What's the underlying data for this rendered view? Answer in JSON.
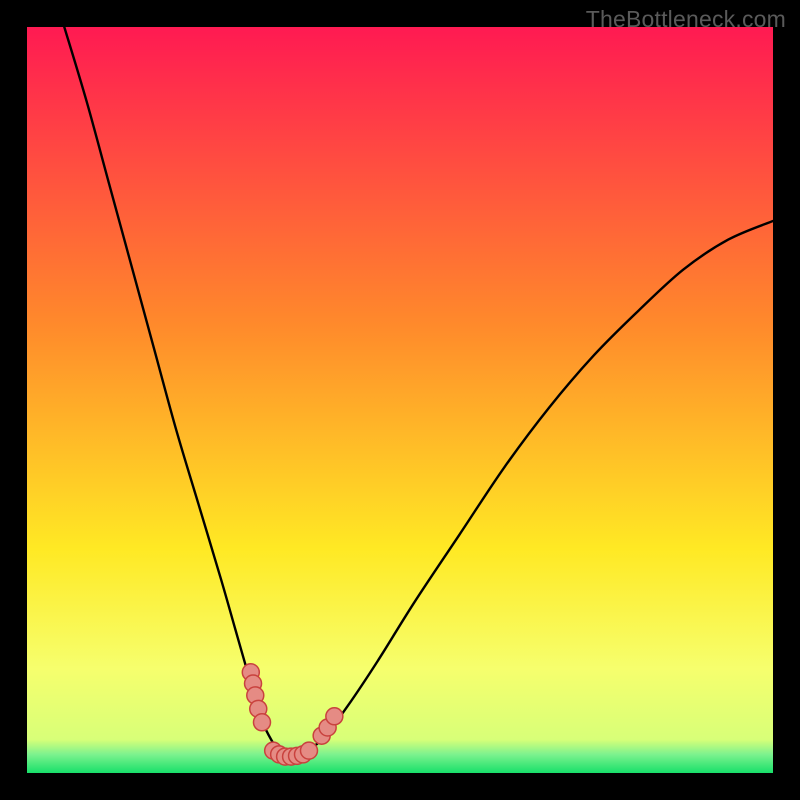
{
  "watermark": "TheBottleneck.com",
  "colors": {
    "frame": "#000000",
    "grad_top": "#ff1a52",
    "grad_mid1": "#ff8a2b",
    "grad_mid2": "#ffe924",
    "grad_low": "#f6ff6d",
    "grad_green": "#18e06a",
    "line": "#000000",
    "marker_fill": "#e58b84",
    "marker_stroke": "#c9423e"
  },
  "chart_data": {
    "type": "line",
    "title": "",
    "xlabel": "",
    "ylabel": "",
    "xlim": [
      0,
      100
    ],
    "ylim": [
      0,
      100
    ],
    "notes": "V-shaped bottleneck curve. x and y are in percent of the inner plot area (0,0 = bottom-left). The curve reaches its minimum near x≈33–37 at y≈2 (green band). Markers cluster at the bottom of the V on the left and right shoulders and along the trough.",
    "series": [
      {
        "name": "bottleneck-curve",
        "x": [
          5,
          8,
          11,
          14,
          17,
          20,
          23,
          26,
          28,
          30,
          31.5,
          33,
          34,
          35,
          36,
          37,
          38,
          40,
          43,
          47,
          52,
          58,
          64,
          70,
          76,
          82,
          88,
          94,
          100
        ],
        "y": [
          100,
          90,
          79,
          68,
          57,
          46,
          36,
          26,
          19,
          12,
          7,
          4,
          2.5,
          2.2,
          2.2,
          2.5,
          3.2,
          5,
          9,
          15,
          23,
          32,
          41,
          49,
          56,
          62,
          67.5,
          71.5,
          74
        ]
      }
    ],
    "markers": {
      "name": "highlight-points",
      "points": [
        {
          "x": 30.0,
          "y": 13.5
        },
        {
          "x": 30.3,
          "y": 12.0
        },
        {
          "x": 30.6,
          "y": 10.4
        },
        {
          "x": 31.0,
          "y": 8.6
        },
        {
          "x": 31.5,
          "y": 6.8
        },
        {
          "x": 39.5,
          "y": 5.0
        },
        {
          "x": 40.3,
          "y": 6.1
        },
        {
          "x": 41.2,
          "y": 7.6
        },
        {
          "x": 33.0,
          "y": 3.0
        },
        {
          "x": 33.8,
          "y": 2.5
        },
        {
          "x": 34.6,
          "y": 2.2
        },
        {
          "x": 35.4,
          "y": 2.2
        },
        {
          "x": 36.2,
          "y": 2.3
        },
        {
          "x": 37.0,
          "y": 2.5
        },
        {
          "x": 37.8,
          "y": 3.0
        }
      ]
    },
    "background_gradient_stops": [
      {
        "pos": 0.0,
        "color": "#ff1a52"
      },
      {
        "pos": 0.4,
        "color": "#ff8a2b"
      },
      {
        "pos": 0.7,
        "color": "#ffe924"
      },
      {
        "pos": 0.86,
        "color": "#f6ff6d"
      },
      {
        "pos": 0.955,
        "color": "#d8ff78"
      },
      {
        "pos": 0.975,
        "color": "#7df28e"
      },
      {
        "pos": 1.0,
        "color": "#18e06a"
      }
    ]
  }
}
